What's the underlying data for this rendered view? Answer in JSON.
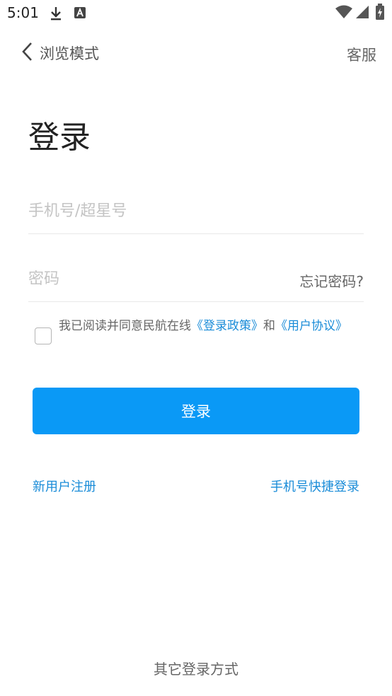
{
  "status_bar": {
    "time": "5:01",
    "icons": [
      "download-icon",
      "font-a-icon",
      "wifi-icon",
      "signal-icon",
      "battery-charging-icon"
    ]
  },
  "nav": {
    "back_label": "浏览模式",
    "service_label": "客服"
  },
  "page": {
    "title": "登录"
  },
  "form": {
    "account_placeholder": "手机号/超星号",
    "password_placeholder": "密码",
    "forgot_label": "忘记密码?"
  },
  "agreement": {
    "prefix": "我已阅读并同意民航在线",
    "policy_link": "《登录政策》",
    "joiner": "和",
    "terms_link": "《用户协议》",
    "checked": false
  },
  "actions": {
    "login_label": "登录",
    "register_label": "新用户注册",
    "quick_login_label": "手机号快捷登录",
    "other_login_label": "其它登录方式"
  },
  "colors": {
    "accent": "#0a99f6",
    "link": "#1a8cd8"
  }
}
